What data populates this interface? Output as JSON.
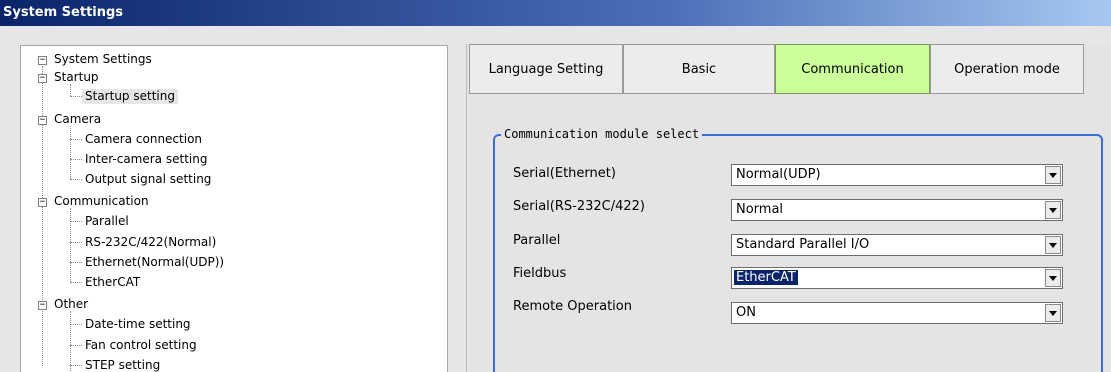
{
  "window": {
    "title": "System Settings"
  },
  "tree": {
    "root": "System Settings",
    "groups": [
      {
        "label": "Startup",
        "children": [
          "Startup setting"
        ]
      },
      {
        "label": "Camera",
        "children": [
          "Camera connection",
          "Inter-camera setting",
          "Output signal setting"
        ]
      },
      {
        "label": "Communication",
        "children": [
          "Parallel",
          "RS-232C/422(Normal)",
          "Ethernet(Normal(UDP))",
          "EtherCAT"
        ]
      },
      {
        "label": "Other",
        "children": [
          "Date-time setting",
          "Fan control setting",
          "STEP setting"
        ]
      }
    ],
    "selected": "Startup setting",
    "expander_symbol": "−"
  },
  "tabs": [
    {
      "label": "Language Setting"
    },
    {
      "label": "Basic"
    },
    {
      "label": "Communication"
    },
    {
      "label": "Operation mode"
    }
  ],
  "active_tab": "Communication",
  "communication": {
    "group_title": "Communication module select",
    "rows": [
      {
        "label": "Serial(Ethernet)",
        "value": "Normal(UDP)"
      },
      {
        "label": "Serial(RS-232C/422)",
        "value": "Normal"
      },
      {
        "label": "Parallel",
        "value": "Standard Parallel I/O"
      },
      {
        "label": "Fieldbus",
        "value": "EtherCAT"
      },
      {
        "label": "Remote Operation",
        "value": "ON"
      }
    ],
    "focused_field": "Fieldbus"
  },
  "colors": {
    "active_tab": "#ccff99",
    "group_border": "#3a6fd8",
    "selection": "#0a246a",
    "titlebar": "#0a246a"
  }
}
